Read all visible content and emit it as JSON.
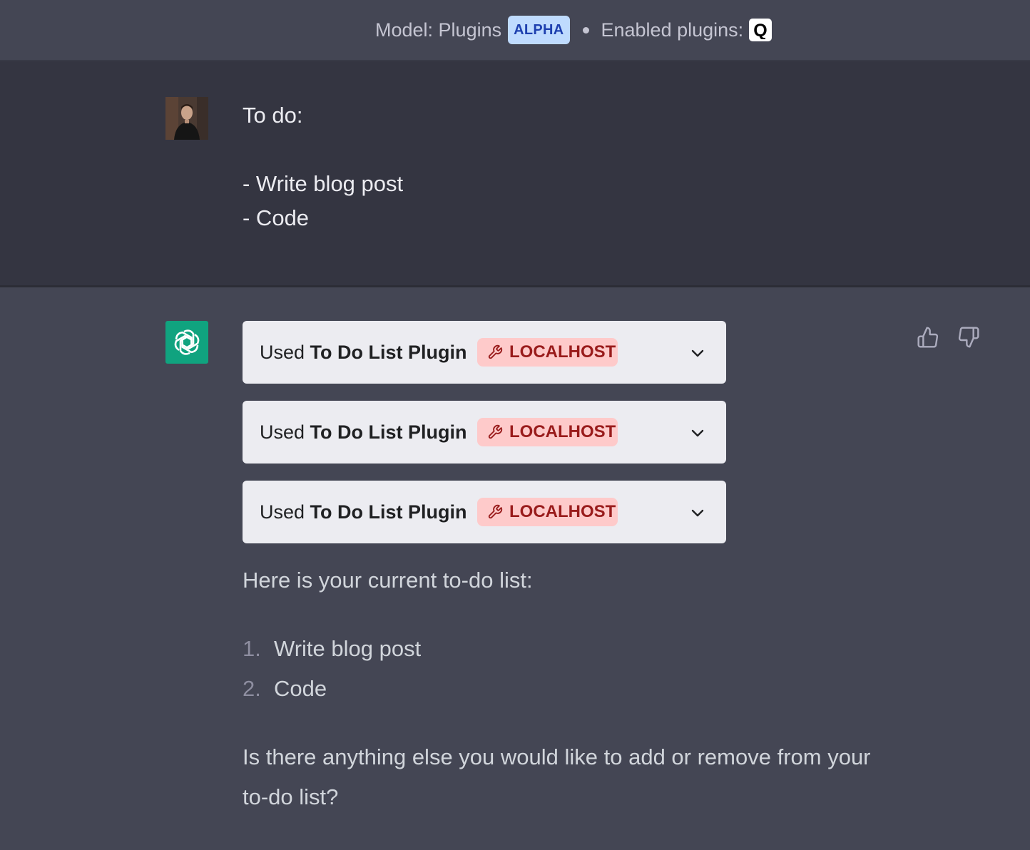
{
  "header": {
    "model_label": "Model: Plugins",
    "model_badge": "ALPHA",
    "enabled_label": "Enabled plugins:",
    "plugin_logo_letter": "Q"
  },
  "user_message": {
    "text": "To do:\n\n- Write blog post\n- Code"
  },
  "assistant": {
    "plugin_calls": [
      {
        "prefix": "Used",
        "name": "To Do List Plugin",
        "badge": "LOCALHOST"
      },
      {
        "prefix": "Used",
        "name": "To Do List Plugin",
        "badge": "LOCALHOST"
      },
      {
        "prefix": "Used",
        "name": "To Do List Plugin",
        "badge": "LOCALHOST"
      }
    ],
    "intro": "Here is your current to-do list:",
    "list": [
      {
        "num": "1.",
        "text": "Write blog post"
      },
      {
        "num": "2.",
        "text": "Code"
      }
    ],
    "closing_line1": "Is there anything else you would like to add or remove from your",
    "closing_line2": "to-do list?"
  },
  "icons": {
    "avatar_user": "user-avatar",
    "avatar_assistant": "openai-logo-icon",
    "thumbs_up": "thumbs-up-icon",
    "thumbs_down": "thumbs-down-icon",
    "chevron": "chevron-down-icon",
    "wrench": "wrench-icon"
  },
  "colors": {
    "chat_bg": "#444654",
    "user_bg": "#343541",
    "alpha_badge_bg": "#bfdbfe",
    "localhost_badge_bg": "#fecaca",
    "localhost_badge_text": "#991b1b",
    "assistant_avatar": "#10a37f"
  }
}
